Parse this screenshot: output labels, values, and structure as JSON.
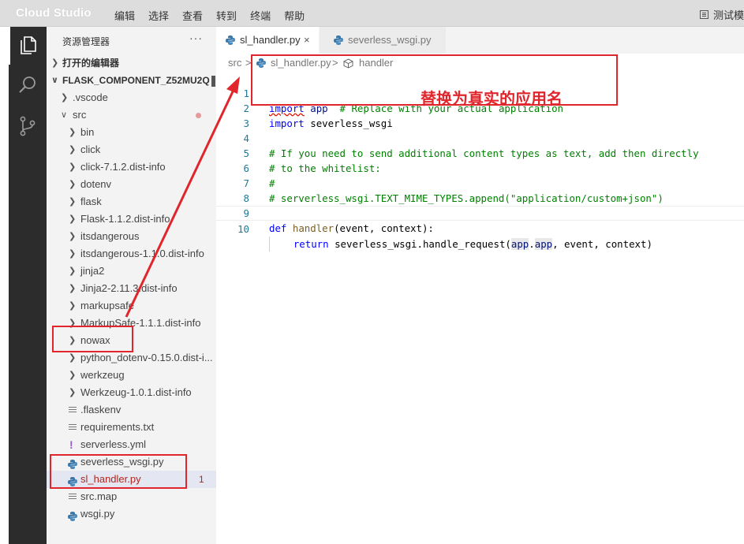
{
  "titlebar": {
    "brand": "Cloud Studio",
    "menu": [
      "编辑",
      "选择",
      "查看",
      "转到",
      "终端",
      "帮助"
    ],
    "right_text": "测试模"
  },
  "activity_bar": {
    "icons": [
      "explorer-icon",
      "search-icon",
      "source-control-icon"
    ]
  },
  "sidebar": {
    "title": "资源管理器",
    "more": "···",
    "open_editors": "打开的编辑器",
    "workspace": "FLASK_COMPONENT_Z52MU2Q",
    "items": [
      {
        "label": ".vscode",
        "kind": "folder",
        "depth": 1
      },
      {
        "label": "src",
        "kind": "folder-open",
        "depth": 1
      },
      {
        "label": "bin",
        "kind": "folder",
        "depth": 2
      },
      {
        "label": "click",
        "kind": "folder",
        "depth": 2
      },
      {
        "label": "click-7.1.2.dist-info",
        "kind": "folder",
        "depth": 2
      },
      {
        "label": "dotenv",
        "kind": "folder",
        "depth": 2
      },
      {
        "label": "flask",
        "kind": "folder",
        "depth": 2
      },
      {
        "label": "Flask-1.1.2.dist-info",
        "kind": "folder",
        "depth": 2
      },
      {
        "label": "itsdangerous",
        "kind": "folder",
        "depth": 2
      },
      {
        "label": "itsdangerous-1.1.0.dist-info",
        "kind": "folder",
        "depth": 2
      },
      {
        "label": "jinja2",
        "kind": "folder",
        "depth": 2
      },
      {
        "label": "Jinja2-2.11.3.dist-info",
        "kind": "folder",
        "depth": 2
      },
      {
        "label": "markupsafe",
        "kind": "folder",
        "depth": 2
      },
      {
        "label": "MarkupSafe-1.1.1.dist-info",
        "kind": "folder",
        "depth": 2
      },
      {
        "label": "nowax",
        "kind": "folder",
        "depth": 2
      },
      {
        "label": "python_dotenv-0.15.0.dist-i...",
        "kind": "folder",
        "depth": 2
      },
      {
        "label": "werkzeug",
        "kind": "folder",
        "depth": 2
      },
      {
        "label": "Werkzeug-1.0.1.dist-info",
        "kind": "folder",
        "depth": 2
      },
      {
        "label": ".flaskenv",
        "kind": "file-lines",
        "depth": 2
      },
      {
        "label": "requirements.txt",
        "kind": "file-lines",
        "depth": 2
      },
      {
        "label": "serverless.yml",
        "kind": "file-yml",
        "depth": 2
      },
      {
        "label": "severless_wsgi.py",
        "kind": "file-py",
        "depth": 2
      },
      {
        "label": "sl_handler.py",
        "kind": "file-py",
        "depth": 2,
        "badge": "1"
      },
      {
        "label": "src.map",
        "kind": "file-lines",
        "depth": 2
      },
      {
        "label": "wsgi.py",
        "kind": "file-py",
        "depth": 2
      }
    ]
  },
  "tabs": [
    {
      "label": "sl_handler.py",
      "active": true,
      "close": "×"
    },
    {
      "label": "severless_wsgi.py",
      "active": false
    }
  ],
  "breadcrumb": {
    "root": "src",
    "file": "sl_handler.py",
    "symbol": "handler",
    "sep": ">"
  },
  "code": {
    "line_numbers": [
      "1",
      "2",
      "3",
      "4",
      "5",
      "6",
      "7",
      "8",
      "9",
      "10"
    ],
    "l1": {
      "kw": "import",
      "mod": "app",
      "comment": "# Replace with your actual application"
    },
    "l2": {
      "kw": "import",
      "mod": "severless_wsgi"
    },
    "l4": "# If you need to send additional content types as text, add then directly",
    "l5": "# to the whitelist:",
    "l6": "#",
    "l7": "# serverless_wsgi.TEXT_MIME_TYPES.append(\"application/custom+json\")",
    "l9": {
      "kw": "def",
      "fn": "handler",
      "rest": "(event, context):"
    },
    "l10": {
      "kw": "return",
      "call": "severless_wsgi.handle_request(",
      "arg1": "app",
      "dot": ".",
      "arg2": "app",
      "rest": ", event, context)"
    }
  },
  "annotation": {
    "text": "替换为真实的应用名",
    "color": "#e0262c"
  }
}
